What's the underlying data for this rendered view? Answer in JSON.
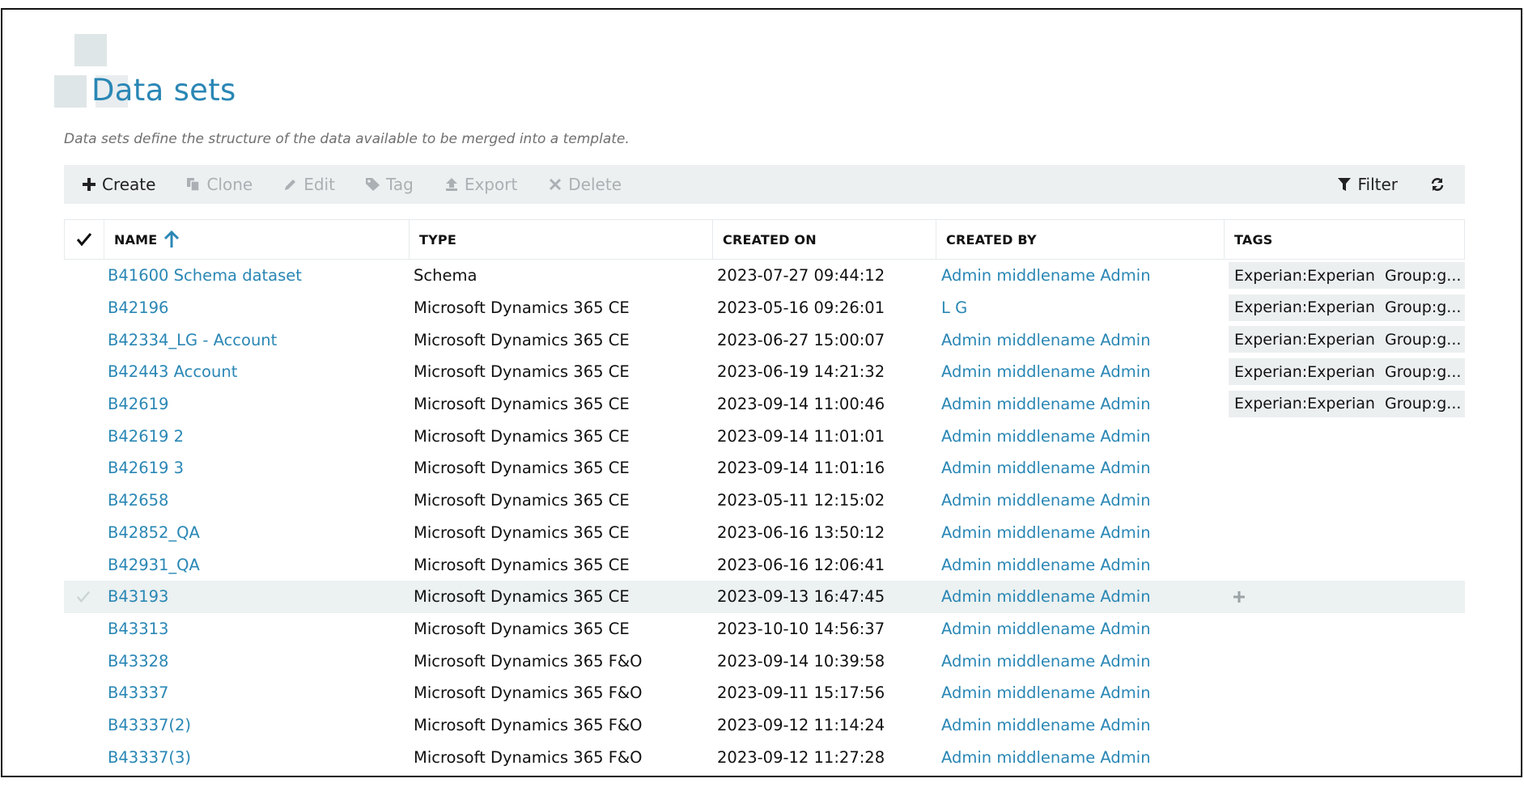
{
  "page": {
    "title": "Data sets",
    "subtitle": "Data sets define the structure of the data available to be merged into a template."
  },
  "toolbar": {
    "create": "Create",
    "clone": "Clone",
    "edit": "Edit",
    "tag": "Tag",
    "export": "Export",
    "delete": "Delete",
    "filter": "Filter"
  },
  "table": {
    "headers": {
      "name": "NAME",
      "type": "TYPE",
      "created_on": "CREATED ON",
      "created_by": "CREATED BY",
      "tags": "TAGS"
    },
    "sort": {
      "column": "name",
      "direction": "ascending"
    },
    "rows": [
      {
        "name": "B41600 Schema dataset",
        "type": "Schema",
        "created_on": "2023-07-27 09:44:12",
        "created_by": "Admin middlename Admin",
        "tag1": "Experian:Experian",
        "tag2": "Group:g..."
      },
      {
        "name": "B42196",
        "type": "Microsoft Dynamics 365 CE",
        "created_on": "2023-05-16 09:26:01",
        "created_by": "L G",
        "tag1": "Experian:Experian",
        "tag2": "Group:g..."
      },
      {
        "name": "B42334_LG - Account",
        "type": "Microsoft Dynamics 365 CE",
        "created_on": "2023-06-27 15:00:07",
        "created_by": "Admin middlename Admin",
        "tag1": "Experian:Experian",
        "tag2": "Group:g..."
      },
      {
        "name": "B42443 Account",
        "type": "Microsoft Dynamics 365 CE",
        "created_on": "2023-06-19 14:21:32",
        "created_by": "Admin middlename Admin",
        "tag1": "Experian:Experian",
        "tag2": "Group:g..."
      },
      {
        "name": "B42619",
        "type": "Microsoft Dynamics 365 CE",
        "created_on": "2023-09-14 11:00:46",
        "created_by": "Admin middlename Admin",
        "tag1": "Experian:Experian",
        "tag2": "Group:g..."
      },
      {
        "name": "B42619 2",
        "type": "Microsoft Dynamics 365 CE",
        "created_on": "2023-09-14 11:01:01",
        "created_by": "Admin middlename Admin",
        "tag1": "",
        "tag2": ""
      },
      {
        "name": "B42619 3",
        "type": "Microsoft Dynamics 365 CE",
        "created_on": "2023-09-14 11:01:16",
        "created_by": "Admin middlename Admin",
        "tag1": "",
        "tag2": ""
      },
      {
        "name": "B42658",
        "type": "Microsoft Dynamics 365 CE",
        "created_on": "2023-05-11 12:15:02",
        "created_by": "Admin middlename Admin",
        "tag1": "",
        "tag2": ""
      },
      {
        "name": "B42852_QA",
        "type": "Microsoft Dynamics 365 CE",
        "created_on": "2023-06-16 13:50:12",
        "created_by": "Admin middlename Admin",
        "tag1": "",
        "tag2": ""
      },
      {
        "name": "B42931_QA",
        "type": "Microsoft Dynamics 365 CE",
        "created_on": "2023-06-16 12:06:41",
        "created_by": "Admin middlename Admin",
        "tag1": "",
        "tag2": ""
      },
      {
        "name": "B43193",
        "type": "Microsoft Dynamics 365 CE",
        "created_on": "2023-09-13 16:47:45",
        "created_by": "Admin middlename Admin",
        "tag1": "",
        "tag2": "",
        "hover": true
      },
      {
        "name": "B43313",
        "type": "Microsoft Dynamics 365 CE",
        "created_on": "2023-10-10 14:56:37",
        "created_by": "Admin middlename Admin",
        "tag1": "",
        "tag2": ""
      },
      {
        "name": "B43328",
        "type": "Microsoft Dynamics 365 F&O",
        "created_on": "2023-09-14 10:39:58",
        "created_by": "Admin middlename Admin",
        "tag1": "",
        "tag2": ""
      },
      {
        "name": "B43337",
        "type": "Microsoft Dynamics 365 F&O",
        "created_on": "2023-09-11 15:17:56",
        "created_by": "Admin middlename Admin",
        "tag1": "",
        "tag2": ""
      },
      {
        "name": "B43337(2)",
        "type": "Microsoft Dynamics 365 F&O",
        "created_on": "2023-09-12 11:14:24",
        "created_by": "Admin middlename Admin",
        "tag1": "",
        "tag2": ""
      },
      {
        "name": "B43337(3)",
        "type": "Microsoft Dynamics 365 F&O",
        "created_on": "2023-09-12 11:27:28",
        "created_by": "Admin middlename Admin",
        "tag1": "",
        "tag2": ""
      }
    ],
    "add_tag_icon": "plus-icon"
  },
  "colors": {
    "accent": "#2a87b5",
    "toolbar_bg": "#ecf0f1",
    "disabled": "#aab0b3",
    "hover_row": "#ecf1f1"
  }
}
